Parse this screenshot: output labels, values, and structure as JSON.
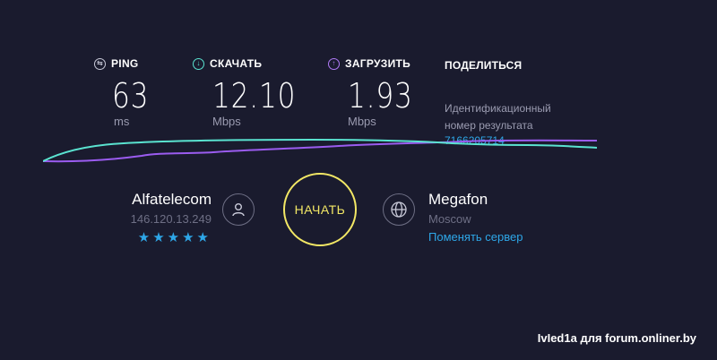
{
  "metrics": {
    "ping": {
      "label": "PING",
      "value": "63",
      "unit": "ms",
      "icon": "ping-icon",
      "color": "#c8c9d8"
    },
    "download": {
      "label": "СКАЧАТЬ",
      "value": "12.10",
      "unit": "Mbps",
      "icon": "download-arrow-icon",
      "color": "#5ae3d0"
    },
    "upload": {
      "label": "ЗАГРУЗИТЬ",
      "value": "1.93",
      "unit": "Mbps",
      "icon": "upload-arrow-icon",
      "color": "#b07af7"
    }
  },
  "share": {
    "label": "ПОДЕЛИТЬСЯ",
    "result_label": "Идентификационный номер результата",
    "result_id": "7166205714"
  },
  "isp": {
    "name": "Alfatelecom",
    "ip": "146.120.13.249",
    "stars": "★★★★★",
    "rating": 5,
    "icon": "user-icon"
  },
  "start_button": {
    "label": "НАЧАТЬ",
    "color": "#f2e765"
  },
  "server": {
    "name": "Megafon",
    "city": "Moscow",
    "change_label": "Поменять сервер",
    "icon": "globe-icon"
  },
  "watermark": "IvIed1a для forum.onliner.by",
  "colors": {
    "background": "#1a1b2e",
    "link": "#2ea7e8",
    "muted": "#9a9bb0"
  }
}
